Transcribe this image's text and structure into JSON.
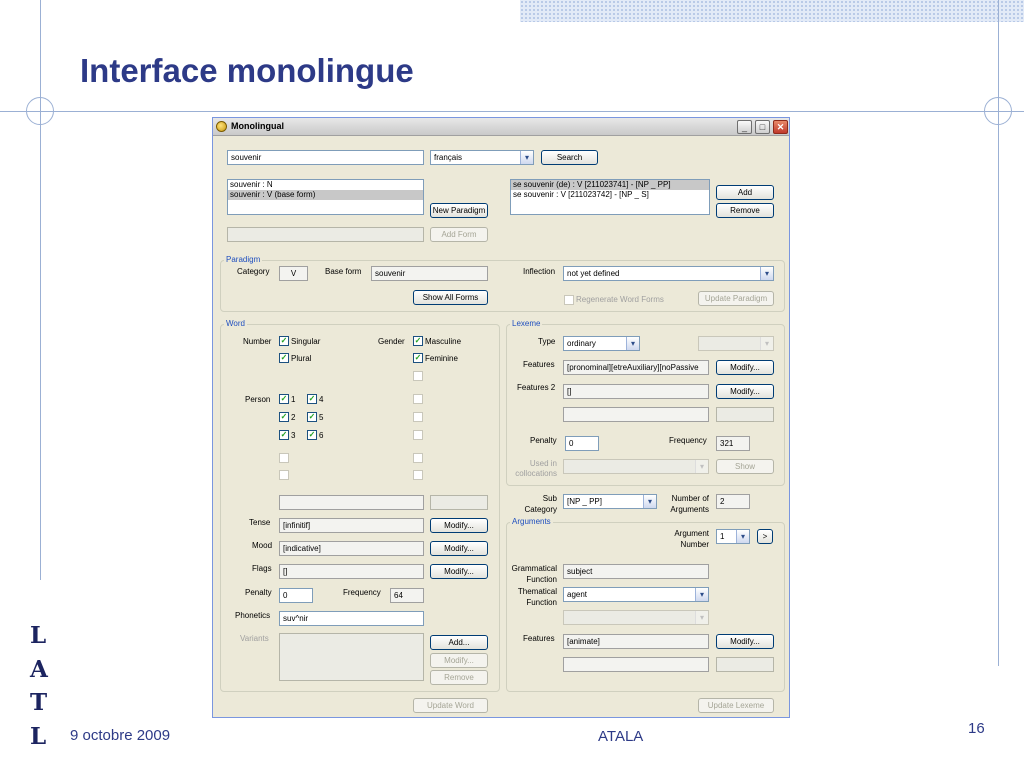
{
  "slide": {
    "title": "Interface monolingue",
    "date": "9 octobre 2009",
    "org": "ATALA",
    "page": "16",
    "logo_letters": [
      "L",
      "A",
      "T",
      "L"
    ]
  },
  "window": {
    "title": "Monolingual",
    "minimize": "_",
    "maximize": "□",
    "close": "✕"
  },
  "search": {
    "query": "souvenir",
    "language": "français",
    "search_button": "Search"
  },
  "words_list": [
    "souvenir : N",
    "souvenir : V (base form)"
  ],
  "new_paradigm_button": "New Paradigm",
  "add_form_button": "Add Form",
  "lexemes_list": [
    "se souvenir  (de) : V [211023741] - [NP _ PP]",
    "se souvenir  : V [211023742] - [NP _ S]"
  ],
  "lexeme_add_button": "Add",
  "lexeme_remove_button": "Remove",
  "paradigm": {
    "group_title": "Paradigm",
    "category_label": "Category",
    "category_value": "V",
    "base_form_label": "Base form",
    "base_form_value": "souvenir",
    "inflection_label": "Inflection",
    "inflection_value": "not yet defined",
    "show_all_forms_button": "Show All Forms",
    "regenerate_label": "Regenerate Word Forms",
    "update_paradigm_button": "Update Paradigm"
  },
  "word": {
    "group_title": "Word",
    "number_label": "Number",
    "singular_label": "Singular",
    "plural_label": "Plural",
    "gender_label": "Gender",
    "masculine_label": "Masculine",
    "feminine_label": "Feminine",
    "person_label": "Person",
    "persons": [
      "1",
      "2",
      "3",
      "4",
      "5",
      "6"
    ],
    "tense_label": "Tense",
    "tense_value": "[infinitif]",
    "mood_label": "Mood",
    "mood_value": "[indicative]",
    "flags_label": "Flags",
    "flags_value": "[]",
    "modify_button": "Modify...",
    "penalty_label": "Penalty",
    "penalty_value": "0",
    "frequency_label": "Frequency",
    "frequency_value": "64",
    "phonetics_label": "Phonetics",
    "phonetics_value": "suv^nir",
    "variants_label": "Variants",
    "add_button": "Add...",
    "variant_modify_button": "Modify...",
    "remove_button": "Remove",
    "update_word_button": "Update Word",
    "checked_mark": "✓"
  },
  "lexeme": {
    "group_title": "Lexeme",
    "type_label": "Type",
    "type_value": "ordinary",
    "features_label": "Features",
    "features_value": "[pronominal][etreAuxiliary][noPassive",
    "features2_label": "Features 2",
    "features2_value": "[]",
    "modify_button": "Modify...",
    "penalty_label": "Penalty",
    "penalty_value": "0",
    "frequency_label": "Frequency",
    "frequency_value": "321",
    "collocations_label_1": "Used in",
    "collocations_label_2": "collocations",
    "show_button": "Show",
    "subcat_label_1": "Sub",
    "subcat_label_2": "Category",
    "subcat_value": "[NP _ PP]",
    "num_args_label_1": "Number of",
    "num_args_label_2": "Arguments",
    "num_args_value": "2",
    "update_lexeme_button": "Update Lexeme"
  },
  "arguments": {
    "group_title": "Arguments",
    "arg_number_label_1": "Argument",
    "arg_number_label_2": "Number",
    "arg_number_value": "1",
    "next_button": ">",
    "gram_func_label_1": "Grammatical",
    "gram_func_label_2": "Function",
    "gram_func_value": "subject",
    "them_func_label_1": "Thematical",
    "them_func_label_2": "Function",
    "them_func_value": "agent",
    "features_label": "Features",
    "features_value": "[animate]",
    "modify_button": "Modify..."
  },
  "dropdown_arrow": "▾",
  "colors": {
    "title_blue": "#2d3a87",
    "group_title_blue": "#1f4fbf",
    "window_bg": "#ece9d8"
  }
}
